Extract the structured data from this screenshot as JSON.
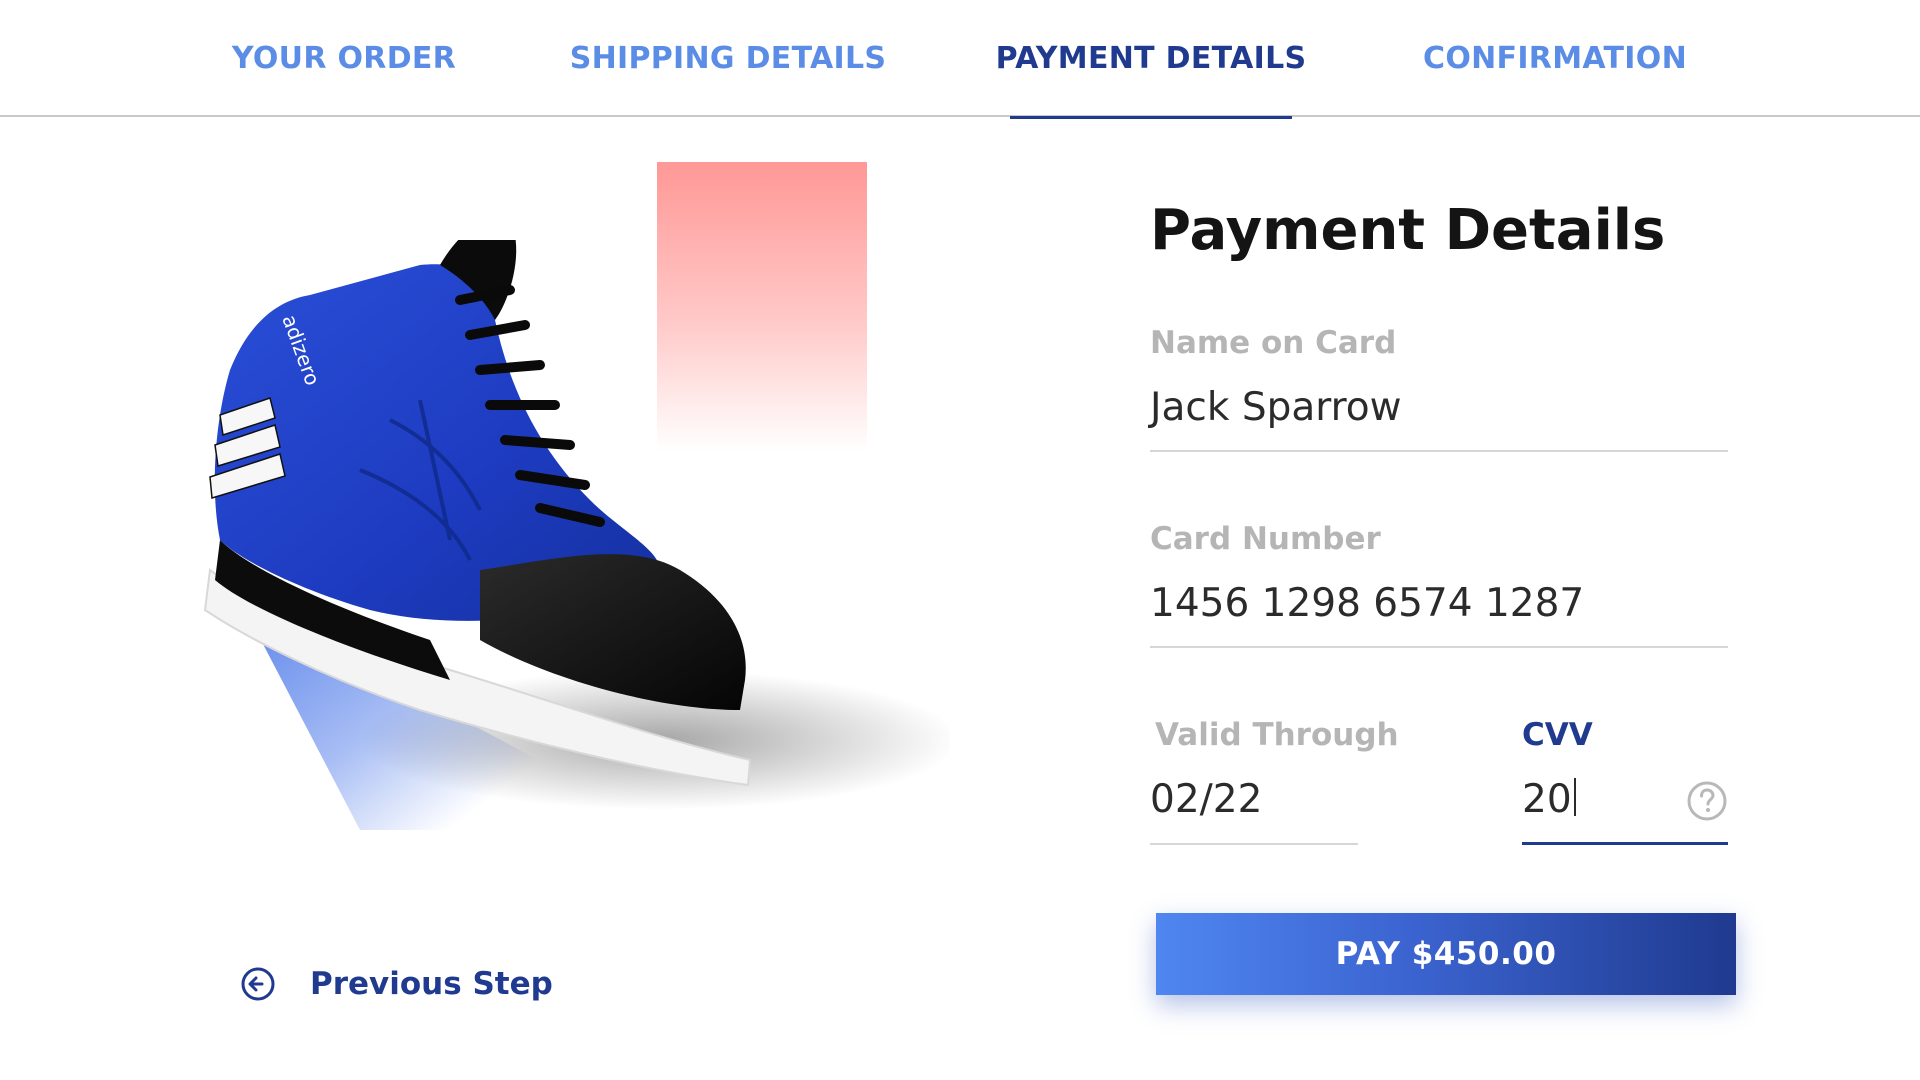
{
  "stepper": {
    "steps": [
      {
        "label": "YOUR ORDER",
        "state": "done"
      },
      {
        "label": "SHIPPING DETAILS",
        "state": "done"
      },
      {
        "label": "PAYMENT DETAILS",
        "state": "active"
      },
      {
        "label": "CONFIRMATION",
        "state": "upcoming"
      }
    ]
  },
  "product": {
    "image_icon": "basketball-shoe",
    "brand_mark": "adizero"
  },
  "navigation": {
    "previous_label": "Previous Step",
    "previous_icon": "arrow-left-circle-icon"
  },
  "payment": {
    "title": "Payment Details",
    "name_label": "Name on Card",
    "name_value": "Jack Sparrow",
    "card_label": "Card Number",
    "card_value": "1456 1298 6574 1287",
    "valid_label": "Valid Through",
    "valid_value": "02/22",
    "cvv_label": "CVV",
    "cvv_value": "20",
    "cvv_help_icon": "question-circle-icon",
    "pay_label": "PAY $450.00"
  },
  "colors": {
    "accent_dark": "#1f3a8f",
    "accent_light": "#5b8de6",
    "pink_block": "#ff9896",
    "blue_wedge": "#5a82ea"
  }
}
